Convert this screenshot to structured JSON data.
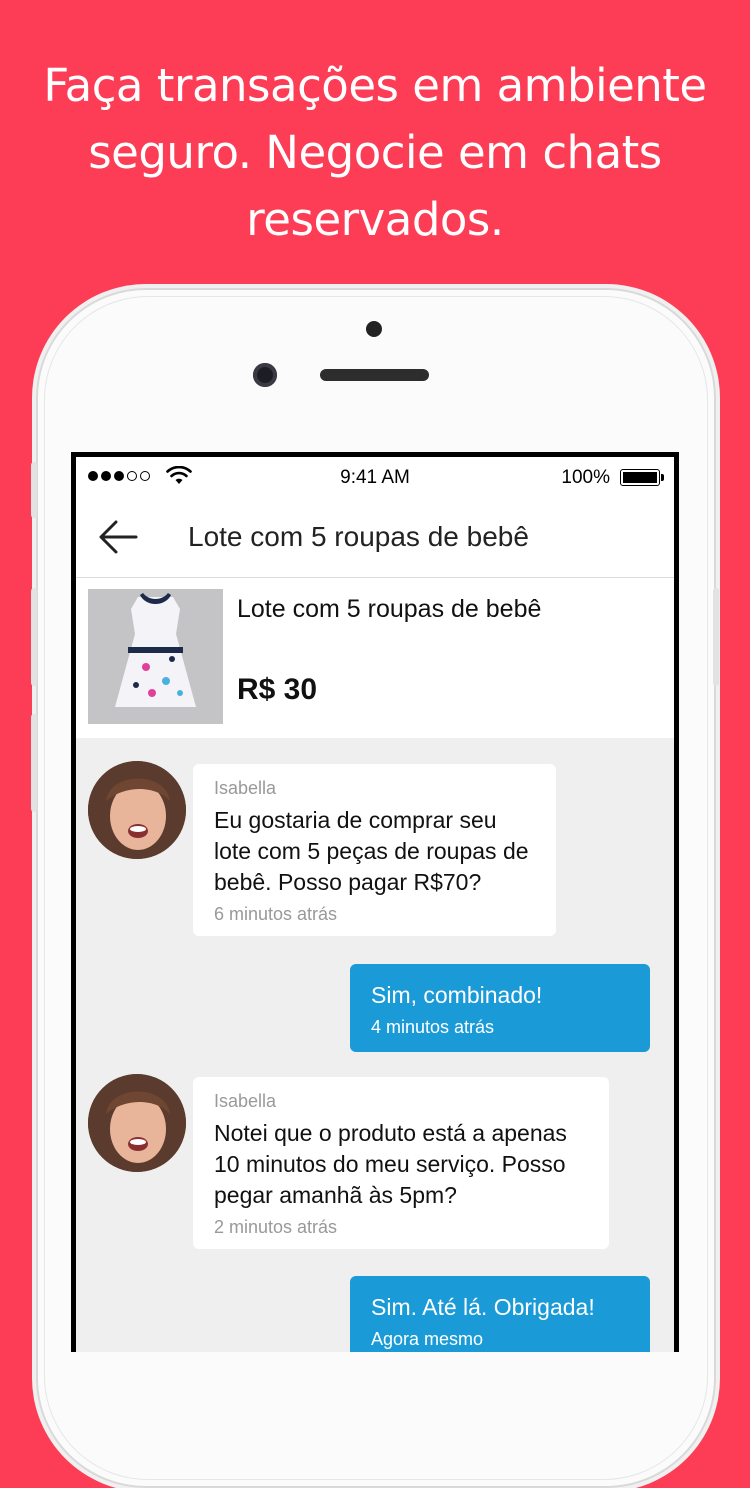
{
  "headline": {
    "line1": "Faça transações em ambiente",
    "line2": "seguro. Negocie em chats",
    "line3": "reservados."
  },
  "status_bar": {
    "time": "9:41 AM",
    "battery": "100%"
  },
  "nav": {
    "title": "Lote com 5 roupas de bebê"
  },
  "product": {
    "title": "Lote com 5 roupas de bebê",
    "price": "R$ 30"
  },
  "messages": [
    {
      "direction": "incoming",
      "sender": "Isabella",
      "text": "Eu gostaria de comprar seu lote com 5 peças de roupas de bebê. Posso pagar R$70?",
      "time": "6 minutos atrás"
    },
    {
      "direction": "outgoing",
      "text": "Sim, combinado!",
      "time": "4 minutos atrás"
    },
    {
      "direction": "incoming",
      "sender": "Isabella",
      "text": "Notei que o produto está a apenas 10 minutos do meu serviço. Posso pegar amanhã às 5pm?",
      "time": "2 minutos atrás"
    },
    {
      "direction": "outgoing",
      "text": "Sim. Até lá. Obrigada!",
      "time": "Agora mesmo"
    }
  ],
  "colors": {
    "background": "#fc3d55",
    "outgoing_bubble": "#1a9bd7",
    "chat_background": "#efefef"
  }
}
